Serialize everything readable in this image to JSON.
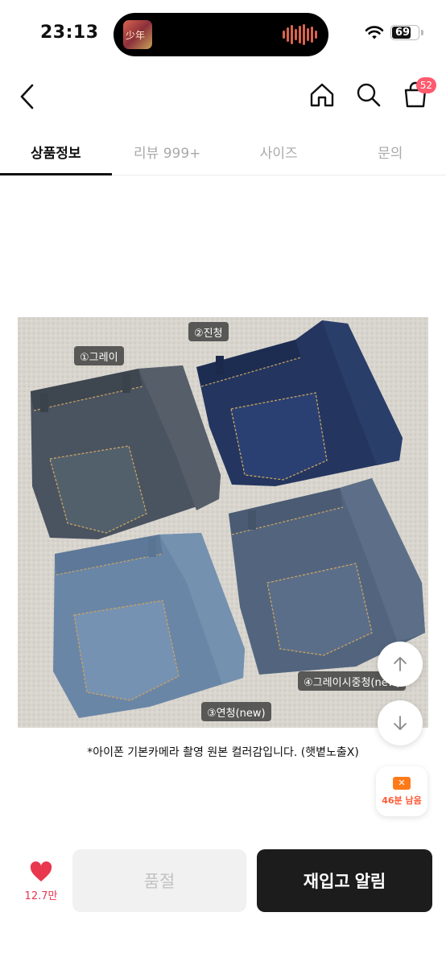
{
  "status_bar": {
    "time": "23:13",
    "battery": "69"
  },
  "nav": {
    "cart_count": "52"
  },
  "tabs": [
    {
      "label": "상품정보",
      "active": true
    },
    {
      "label": "리뷰 999+",
      "active": false
    },
    {
      "label": "사이즈",
      "active": false
    },
    {
      "label": "문의",
      "active": false
    }
  ],
  "product_image": {
    "labels": {
      "gray": "①그레이",
      "dark_blue": "②진청",
      "light_blue": "③연청(new)",
      "gray_mid": "④그레이시중청(new)"
    }
  },
  "caption": "*아이폰 기본카메라 촬영 원본 컬러감입니다. (햇볕노출X)",
  "coupon": {
    "text": "46분 남음"
  },
  "bottom": {
    "like_count": "12.7만",
    "soldout_label": "품절",
    "restock_label": "재입고 알림"
  }
}
